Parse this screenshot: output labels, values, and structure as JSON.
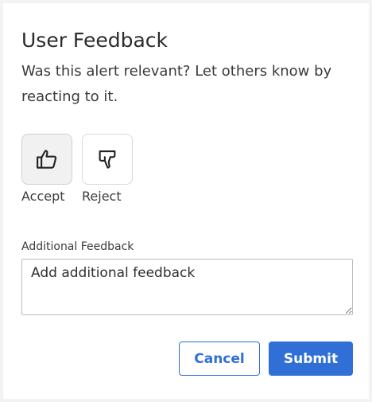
{
  "dialog": {
    "title": "User Feedback",
    "description": "Was this alert relevant? Let others know by reacting to it."
  },
  "reactions": {
    "accept": {
      "label": "Accept",
      "icon": "thumbs-up-icon",
      "selected": true
    },
    "reject": {
      "label": "Reject",
      "icon": "thumbs-down-icon",
      "selected": false
    }
  },
  "feedback": {
    "label": "Additional Feedback",
    "placeholder": "Add additional feedback",
    "value": ""
  },
  "actions": {
    "cancel_label": "Cancel",
    "submit_label": "Submit"
  },
  "colors": {
    "primary": "#2f6fd6",
    "selected_bg": "#f1f1f1",
    "page_bg": "#f3f3f5"
  }
}
